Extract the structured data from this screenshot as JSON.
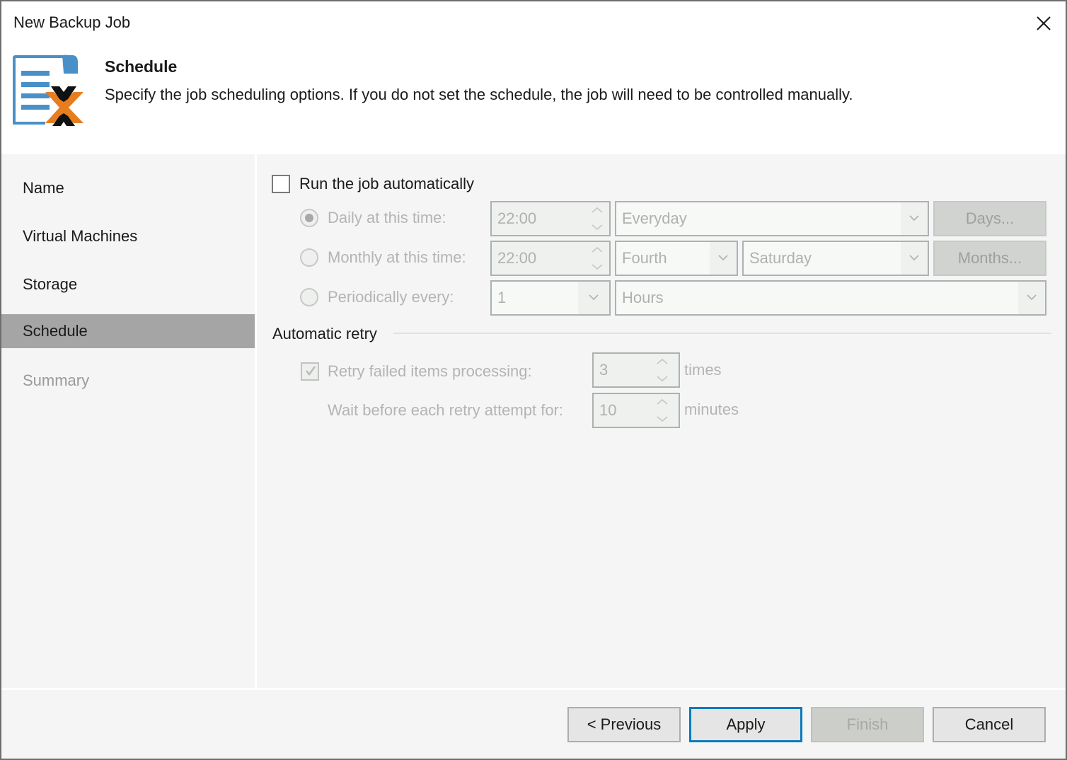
{
  "window": {
    "title": "New Backup Job",
    "close_icon": "close-icon"
  },
  "header": {
    "icon": "backup-job-icon",
    "title": "Schedule",
    "description": "Specify the job scheduling options. If you do not set the schedule, the job will need to be controlled manually."
  },
  "nav": {
    "items": [
      {
        "label": "Name",
        "state": "normal"
      },
      {
        "label": "Virtual Machines",
        "state": "normal"
      },
      {
        "label": "Storage",
        "state": "normal"
      },
      {
        "label": "Schedule",
        "state": "active"
      },
      {
        "label": "Summary",
        "state": "disabled"
      }
    ]
  },
  "schedule": {
    "run_auto": {
      "label": "Run the job automatically",
      "checked": false
    },
    "daily": {
      "label": "Daily at this time:",
      "selected": true,
      "time": "22:00",
      "days_option": "Everyday",
      "button": "Days..."
    },
    "monthly": {
      "label": "Monthly at this time:",
      "selected": false,
      "time": "22:00",
      "week_option": "Fourth",
      "day_option": "Saturday",
      "button": "Months..."
    },
    "periodic": {
      "label": "Periodically every:",
      "selected": false,
      "value": "1",
      "unit": "Hours"
    }
  },
  "retry": {
    "group_title": "Automatic retry",
    "retry_failed": {
      "label": "Retry failed items processing:",
      "checked": true,
      "value": "3",
      "unit": "times"
    },
    "wait": {
      "label": "Wait before each retry attempt for:",
      "value": "10",
      "unit": "minutes"
    }
  },
  "footer": {
    "previous": "< Previous",
    "apply": "Apply",
    "finish": "Finish",
    "cancel": "Cancel"
  },
  "colors": {
    "accent": "#0a7bbd",
    "nav_active": "#a5a5a5",
    "icon_blue": "#4a90c8",
    "icon_orange": "#e87d1e"
  }
}
